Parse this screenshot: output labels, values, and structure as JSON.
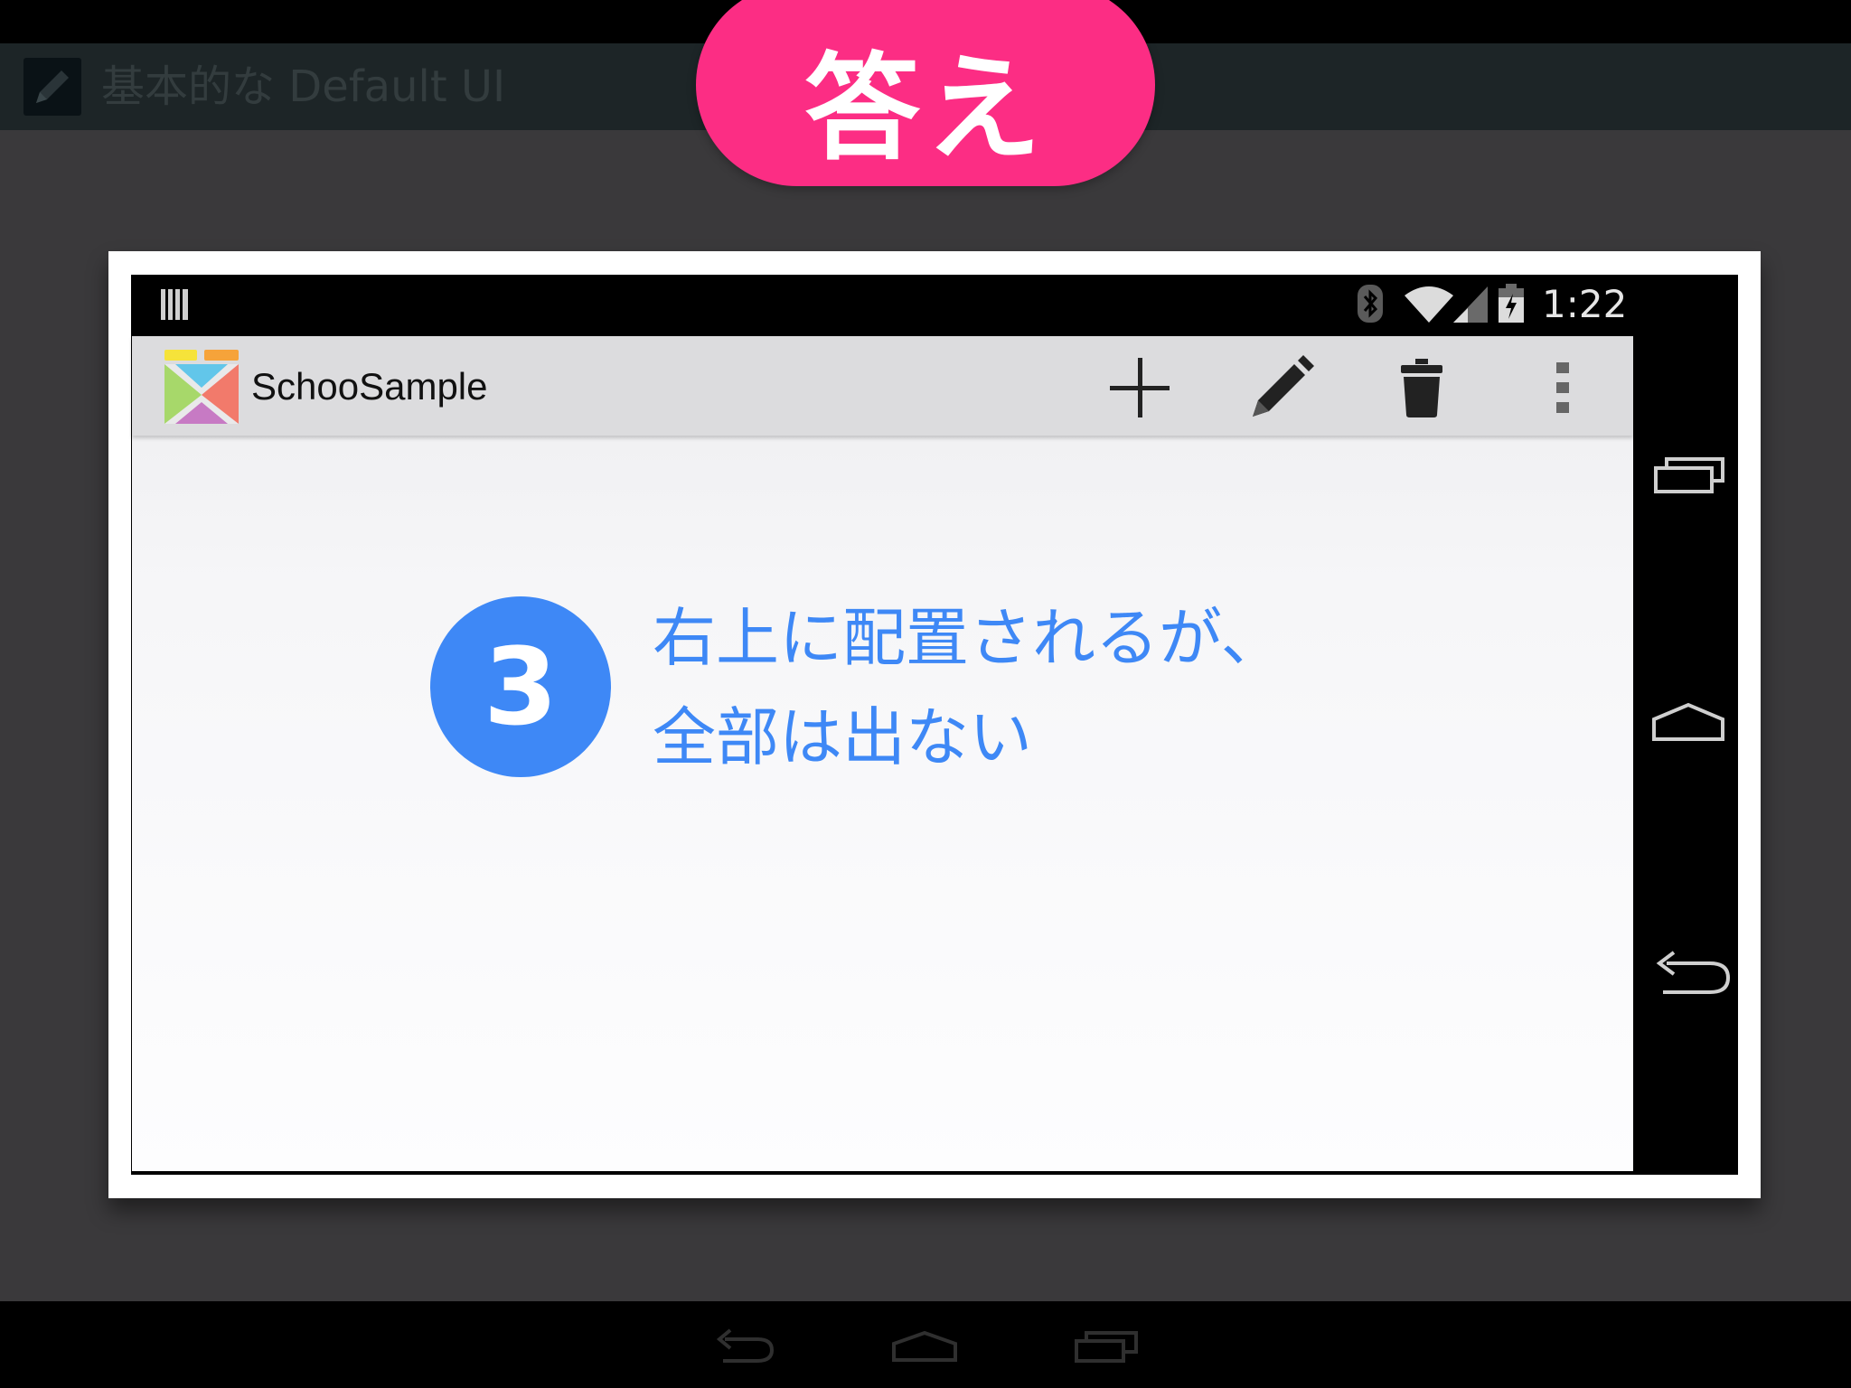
{
  "slide": {
    "title": "基本的な Default UI",
    "answer_badge": "答え",
    "colors": {
      "badge": "#fc2d84",
      "accent": "#3e88f6",
      "titlebar": "#1d2527"
    }
  },
  "device": {
    "clock": "1:22",
    "status_icons": [
      "barcode-icon",
      "bluetooth-icon",
      "wifi-icon",
      "signal-icon",
      "battery-charging-icon"
    ],
    "nav_buttons": [
      "recent-apps-icon",
      "home-icon",
      "back-icon"
    ]
  },
  "app": {
    "title": "SchooSample",
    "actions": [
      "add-icon",
      "edit-icon",
      "delete-icon",
      "overflow-menu-icon"
    ]
  },
  "annotation": {
    "step": "3",
    "line1": "右上に配置されるが、",
    "line2": "全部は出ない"
  }
}
